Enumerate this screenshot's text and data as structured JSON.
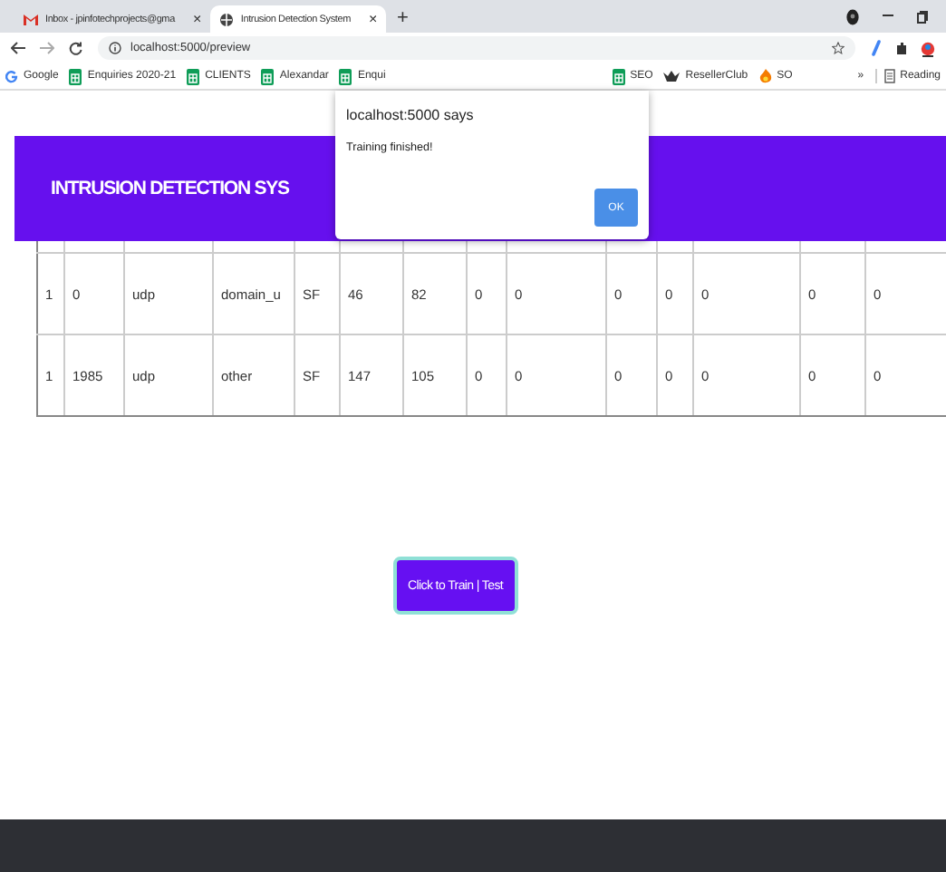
{
  "browser": {
    "tabs": [
      {
        "title": "Inbox - jpinfotechprojects@gma",
        "selected": false,
        "close": "×"
      },
      {
        "title": "Intrusion Detection System",
        "selected": true,
        "close": "×"
      }
    ],
    "new_tab": "+",
    "address": "localhost:5000/preview",
    "bookmarks_left": [
      {
        "label": "Google",
        "kind": "google"
      },
      {
        "label": "Enquiries 2020-21",
        "kind": "sheet"
      },
      {
        "label": "CLIENTS",
        "kind": "sheet"
      },
      {
        "label": "Alexandar",
        "kind": "sheet"
      },
      {
        "label": "Enqui",
        "kind": "sheet"
      }
    ],
    "bookmarks_right": [
      {
        "label": "SEO",
        "kind": "sheet"
      },
      {
        "label": "ResellerClub",
        "kind": "crown"
      },
      {
        "label": "SO",
        "kind": "flame"
      }
    ],
    "more": "»",
    "reading_list": "Reading"
  },
  "header": {
    "title": "INTRUSION DETECTION SYS"
  },
  "table": {
    "rows": [
      [
        "1",
        "0",
        "udp",
        "domain_u",
        "SF",
        "46",
        "82",
        "0",
        "0",
        "0",
        "0",
        "0",
        "0",
        "0"
      ],
      [
        "1",
        "1985",
        "udp",
        "other",
        "SF",
        "147",
        "105",
        "0",
        "0",
        "0",
        "0",
        "0",
        "0",
        "0"
      ]
    ]
  },
  "dialog": {
    "origin": "localhost:5000 says",
    "message": "Training finished!",
    "ok": "OK"
  },
  "train_button": {
    "label": "Click to Train | Test"
  }
}
